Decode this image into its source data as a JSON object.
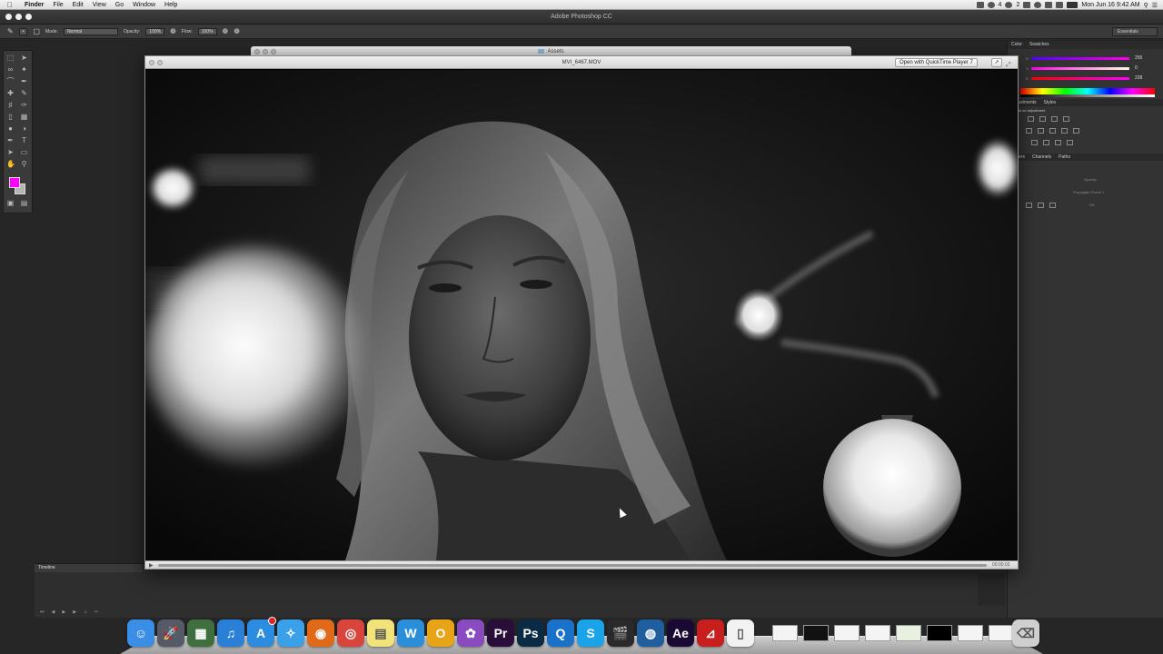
{
  "menubar": {
    "app_name": "Finder",
    "items": [
      "File",
      "Edit",
      "View",
      "Go",
      "Window",
      "Help"
    ],
    "clock": "Mon Jun 16  9:42 AM",
    "status_numbers": [
      "4",
      "2"
    ]
  },
  "photoshop": {
    "title": "Adobe Photoshop CC",
    "options": {
      "mode_label": "Mode:",
      "mode_value": "Normal",
      "opacity_label": "Opacity:",
      "opacity_value": "100%",
      "flow_label": "Flow:",
      "flow_value": "100%"
    },
    "workspace": "Essentials",
    "color_panel": {
      "tabs": [
        "Color",
        "Swatches"
      ],
      "channels": [
        {
          "name": "R",
          "value": "255",
          "color": "#e0205a"
        },
        {
          "name": "G",
          "value": "0",
          "color": "#5050ff"
        },
        {
          "name": "B",
          "value": "228",
          "color": "#e03060"
        }
      ]
    },
    "adjustments_panel": {
      "tabs": [
        "Adjustments",
        "Styles"
      ],
      "heading": "Add an adjustment"
    },
    "layers_panel": {
      "tabs": [
        "Layers",
        "Channels",
        "Paths"
      ],
      "opacity_label": "Opacity:",
      "propagate_label": "Propagate Frame 1",
      "fill_label": "Fill:"
    },
    "timeline": {
      "tab_label": "Timeline"
    },
    "colors": {
      "foreground": "#ff00ff",
      "background": "#b5b5b5"
    }
  },
  "assets_window": {
    "title": "Assets"
  },
  "quicktime": {
    "title": "MVI_6467.MOV",
    "open_button": "Open with QuickTime Player 7",
    "share_icon": "share-icon",
    "time": "00:00:03",
    "progress": 0.0
  },
  "dock": {
    "apps": [
      {
        "name": "Finder",
        "icon": "finder-icon",
        "color": "#3a8ee6",
        "glyph": "☺"
      },
      {
        "name": "Launchpad",
        "icon": "launchpad-icon",
        "color": "#555a66",
        "glyph": "🚀"
      },
      {
        "name": "Mission Control",
        "icon": "mission-control-icon",
        "color": "#3f6f3f",
        "glyph": "▦"
      },
      {
        "name": "iTunes",
        "icon": "itunes-icon",
        "color": "#2a7fd6",
        "glyph": "♫"
      },
      {
        "name": "App Store",
        "icon": "app-store-icon",
        "color": "#2c8de0",
        "glyph": "A"
      },
      {
        "name": "Safari",
        "icon": "safari-icon",
        "color": "#3aa0e8",
        "glyph": "✧"
      },
      {
        "name": "Firefox",
        "icon": "firefox-icon",
        "color": "#e06a1a",
        "glyph": "◉"
      },
      {
        "name": "Chrome",
        "icon": "chrome-icon",
        "color": "#d9453a",
        "glyph": "◎"
      },
      {
        "name": "Stickies",
        "icon": "stickies-icon",
        "color": "#f1e27a",
        "glyph": "▤"
      },
      {
        "name": "Word",
        "icon": "word-icon",
        "color": "#2a8fd8",
        "glyph": "W"
      },
      {
        "name": "Outlook",
        "icon": "outlook-icon",
        "color": "#e8a417",
        "glyph": "O"
      },
      {
        "name": "Photos",
        "icon": "photos-icon",
        "color": "#8a4ac0",
        "glyph": "✿"
      },
      {
        "name": "Premiere Pro",
        "icon": "premiere-icon",
        "color": "#2a0e3a",
        "glyph": "Pr"
      },
      {
        "name": "Photoshop",
        "icon": "photoshop-icon",
        "color": "#0b2a44",
        "glyph": "Ps"
      },
      {
        "name": "QuickTime",
        "icon": "quicktime-icon",
        "color": "#1a72c8",
        "glyph": "Q"
      },
      {
        "name": "Skype",
        "icon": "skype-icon",
        "color": "#1aa3e8",
        "glyph": "S"
      },
      {
        "name": "Final Cut",
        "icon": "clapboard-icon",
        "color": "#2a2a2a",
        "glyph": "🎬"
      },
      {
        "name": "Network",
        "icon": "globe-icon",
        "color": "#1f5fa0",
        "glyph": "◍"
      },
      {
        "name": "After Effects",
        "icon": "after-effects-icon",
        "color": "#1a0a33",
        "glyph": "Ae"
      },
      {
        "name": "Acrobat",
        "icon": "acrobat-icon",
        "color": "#c81e1e",
        "glyph": "⊿"
      },
      {
        "name": "Document",
        "icon": "document-icon",
        "color": "#f2f2f2",
        "glyph": "▯"
      }
    ],
    "trash_icon": "trash-icon"
  }
}
